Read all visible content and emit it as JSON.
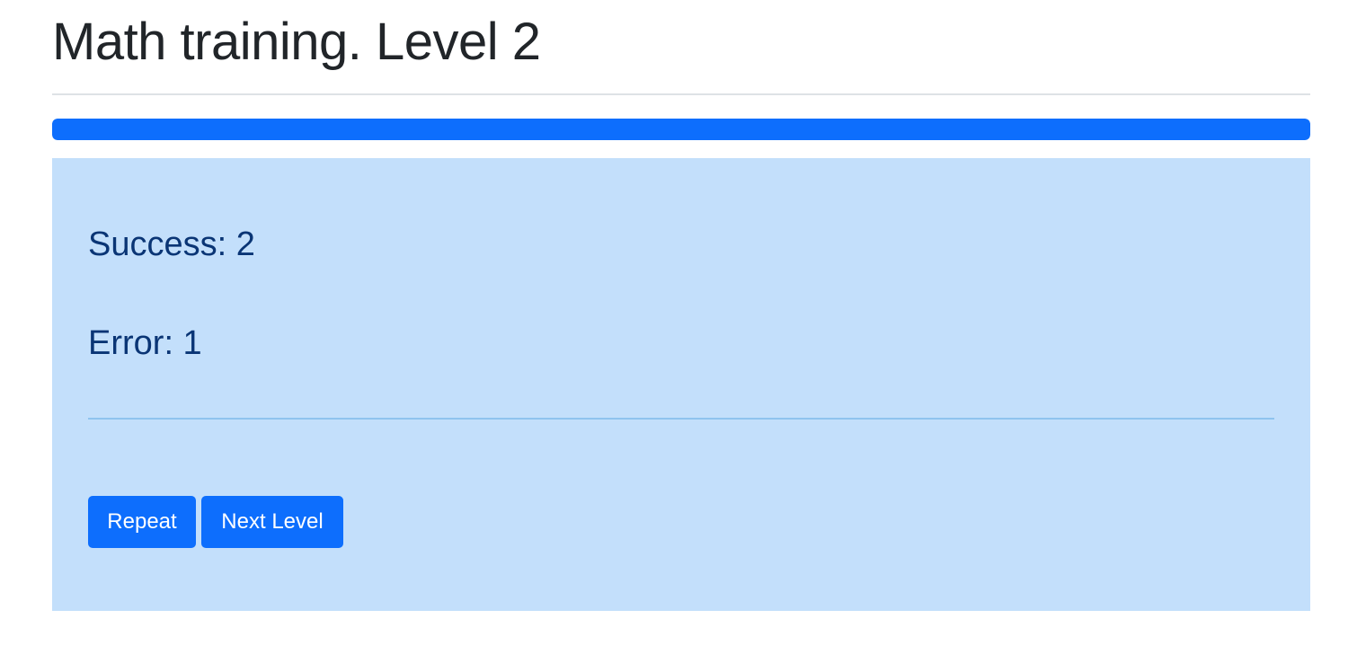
{
  "header": {
    "title": "Math training. Level 2"
  },
  "progress": {
    "value_percent": 100,
    "color": "#0d6efd"
  },
  "results": {
    "success_text": "Success: 2",
    "error_text": "Error: 1",
    "panel_color": "#c3dffb"
  },
  "actions": {
    "repeat_label": "Repeat",
    "next_level_label": "Next Level"
  }
}
